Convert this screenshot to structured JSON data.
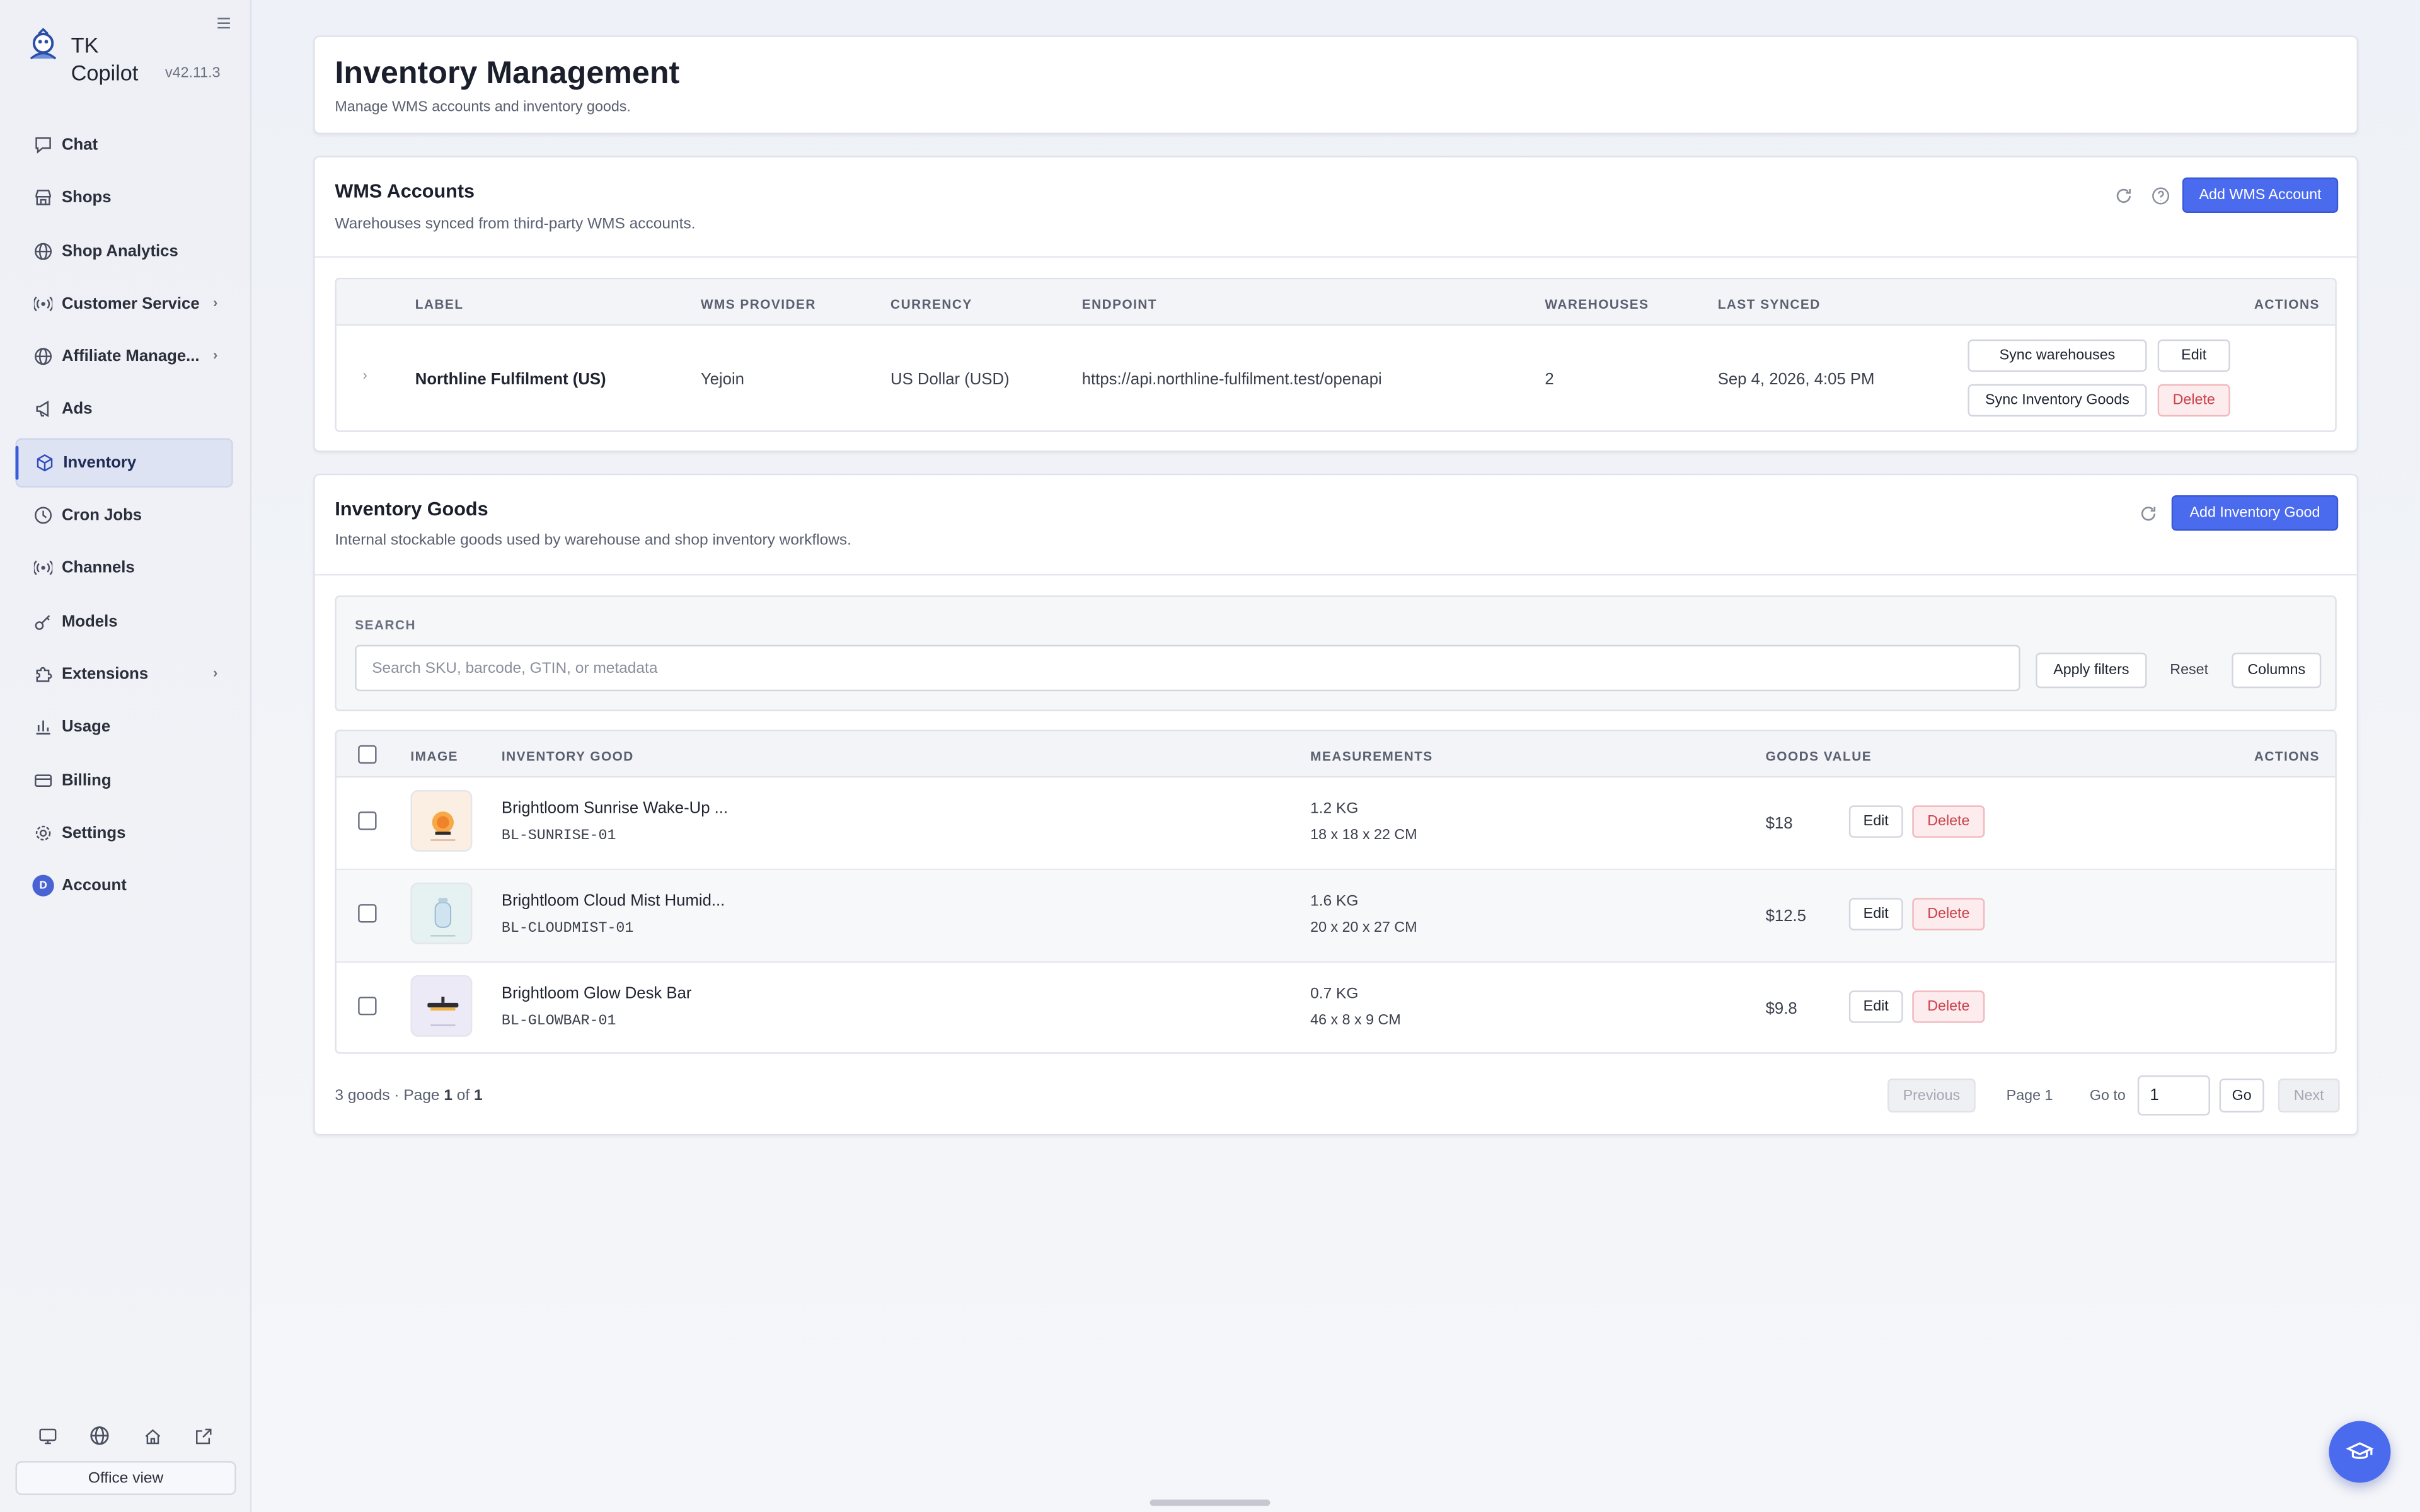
{
  "app": {
    "name": "TK Copilot",
    "version": "v42.11.3"
  },
  "sidebar": {
    "items": [
      {
        "label": "Chat",
        "icon": "chat-icon"
      },
      {
        "label": "Shops",
        "icon": "store-icon"
      },
      {
        "label": "Shop Analytics",
        "icon": "globe-icon"
      },
      {
        "label": "Customer Service",
        "icon": "broadcast-icon"
      },
      {
        "label": "Affiliate Manage...",
        "icon": "globe-icon"
      },
      {
        "label": "Ads",
        "icon": "megaphone-icon"
      },
      {
        "label": "Inventory",
        "icon": "box-icon"
      },
      {
        "label": "Cron Jobs",
        "icon": "clock-icon"
      },
      {
        "label": "Channels",
        "icon": "broadcast-icon"
      },
      {
        "label": "Models",
        "icon": "key-icon"
      },
      {
        "label": "Extensions",
        "icon": "puzzle-icon"
      },
      {
        "label": "Usage",
        "icon": "bar-chart-icon"
      },
      {
        "label": "Billing",
        "icon": "card-icon"
      },
      {
        "label": "Settings",
        "icon": "gear-icon"
      },
      {
        "label": "Account",
        "icon": "avatar"
      }
    ],
    "avatar_initial": "D",
    "office_view": "Office view"
  },
  "header": {
    "title": "Inventory Management",
    "subtitle": "Manage WMS accounts and inventory goods."
  },
  "wms": {
    "title": "WMS Accounts",
    "subtitle": "Warehouses synced from third-party WMS accounts.",
    "add_button": "Add WMS Account",
    "columns": [
      "LABEL",
      "WMS PROVIDER",
      "CURRENCY",
      "ENDPOINT",
      "WAREHOUSES",
      "LAST SYNCED",
      "ACTIONS"
    ],
    "rows": [
      {
        "label": "Northline Fulfilment (US)",
        "provider": "Yejoin",
        "currency": "US Dollar (USD)",
        "endpoint": "https://api.northline-fulfilment.test/openapi",
        "warehouses": "2",
        "last_synced": "Sep 4, 2026, 4:05 PM",
        "actions": {
          "sync_warehouses": "Sync warehouses",
          "edit": "Edit",
          "sync_goods": "Sync Inventory Goods",
          "delete": "Delete"
        }
      }
    ]
  },
  "goods": {
    "title": "Inventory Goods",
    "subtitle": "Internal stockable goods used by warehouse and shop inventory workflows.",
    "add_button": "Add Inventory Good",
    "search": {
      "label": "SEARCH",
      "placeholder": "Search SKU, barcode, GTIN, or metadata",
      "apply": "Apply filters",
      "reset": "Reset",
      "columns": "Columns"
    },
    "columns": [
      "IMAGE",
      "INVENTORY GOOD",
      "MEASUREMENTS",
      "GOODS VALUE",
      "ACTIONS"
    ],
    "rows": [
      {
        "name": "Brightloom Sunrise Wake-Up ...",
        "sku": "BL-SUNRISE-01",
        "weight": "1.2 KG",
        "dims": "18 x 18 x 22 CM",
        "value": "$18",
        "edit": "Edit",
        "delete": "Delete",
        "thumb_color": "#fbeee2"
      },
      {
        "name": "Brightloom Cloud Mist Humid...",
        "sku": "BL-CLOUDMIST-01",
        "weight": "1.6 KG",
        "dims": "20 x 20 x 27 CM",
        "value": "$12.5",
        "edit": "Edit",
        "delete": "Delete",
        "thumb_color": "#e6f2f1"
      },
      {
        "name": "Brightloom Glow Desk Bar",
        "sku": "BL-GLOWBAR-01",
        "weight": "0.7 KG",
        "dims": "46 x 8 x 9 CM",
        "value": "$9.8",
        "edit": "Edit",
        "delete": "Delete",
        "thumb_color": "#eceaf6"
      }
    ],
    "footer": {
      "count": "3 goods · Page ",
      "page_bold": "1",
      "of": " of ",
      "total_bold": "1",
      "previous": "Previous",
      "page_label": "Page 1",
      "goto_label": "Go to",
      "goto_value": "1",
      "go": "Go",
      "next": "Next"
    }
  },
  "colors": {
    "accent": "#4b6bef",
    "danger": "#c9414b"
  }
}
